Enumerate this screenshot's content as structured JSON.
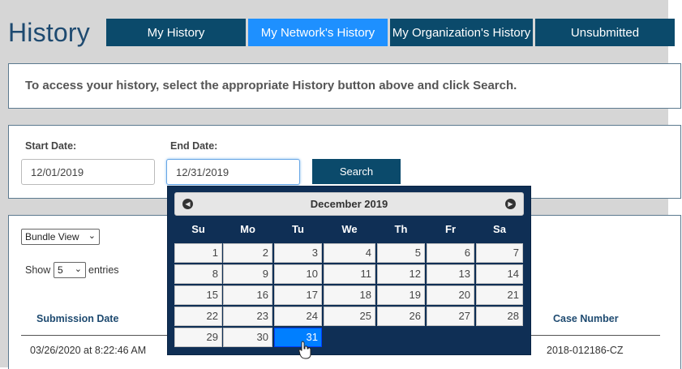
{
  "page": {
    "title": "History"
  },
  "tabs": [
    {
      "label": "My History",
      "active": false
    },
    {
      "label": "My Network's History",
      "active": true
    },
    {
      "label": "My Organization's History",
      "active": false
    },
    {
      "label": "Unsubmitted",
      "active": false
    }
  ],
  "info": {
    "text": "To access your history, select the appropriate History button above and click Search."
  },
  "search_form": {
    "start_label": "Start Date:",
    "start_value": "12/01/2019",
    "end_label": "End Date:",
    "end_value": "12/31/2019",
    "search_button": "Search"
  },
  "results": {
    "view_select": "Bundle View",
    "show_label": "Show",
    "entries_value": "5",
    "entries_label": "entries",
    "columns": {
      "submission_date": "Submission Date",
      "case_number": "Case Number"
    },
    "rows": [
      {
        "submission_date": "03/26/2020 at 8:22:46 AM",
        "case_number": "2018-012186-CZ"
      }
    ]
  },
  "datepicker": {
    "month_title": "December 2019",
    "prev_icon": "circle-triangle-left-icon",
    "next_icon": "circle-triangle-right-icon",
    "weekdays": [
      "Su",
      "Mo",
      "Tu",
      "We",
      "Th",
      "Fr",
      "Sa"
    ],
    "weeks": [
      [
        "1",
        "2",
        "3",
        "4",
        "5",
        "6",
        "7"
      ],
      [
        "8",
        "9",
        "10",
        "11",
        "12",
        "13",
        "14"
      ],
      [
        "15",
        "16",
        "17",
        "18",
        "19",
        "20",
        "21"
      ],
      [
        "22",
        "23",
        "24",
        "25",
        "26",
        "27",
        "28"
      ],
      [
        "29",
        "30",
        "31"
      ]
    ],
    "selected_day": "31"
  },
  "colors": {
    "accent": "#0b4a6b",
    "active_tab": "#1e90ff",
    "title": "#1e4a70",
    "calendar_bg": "#0f2f55",
    "selected_day": "#007fff"
  }
}
